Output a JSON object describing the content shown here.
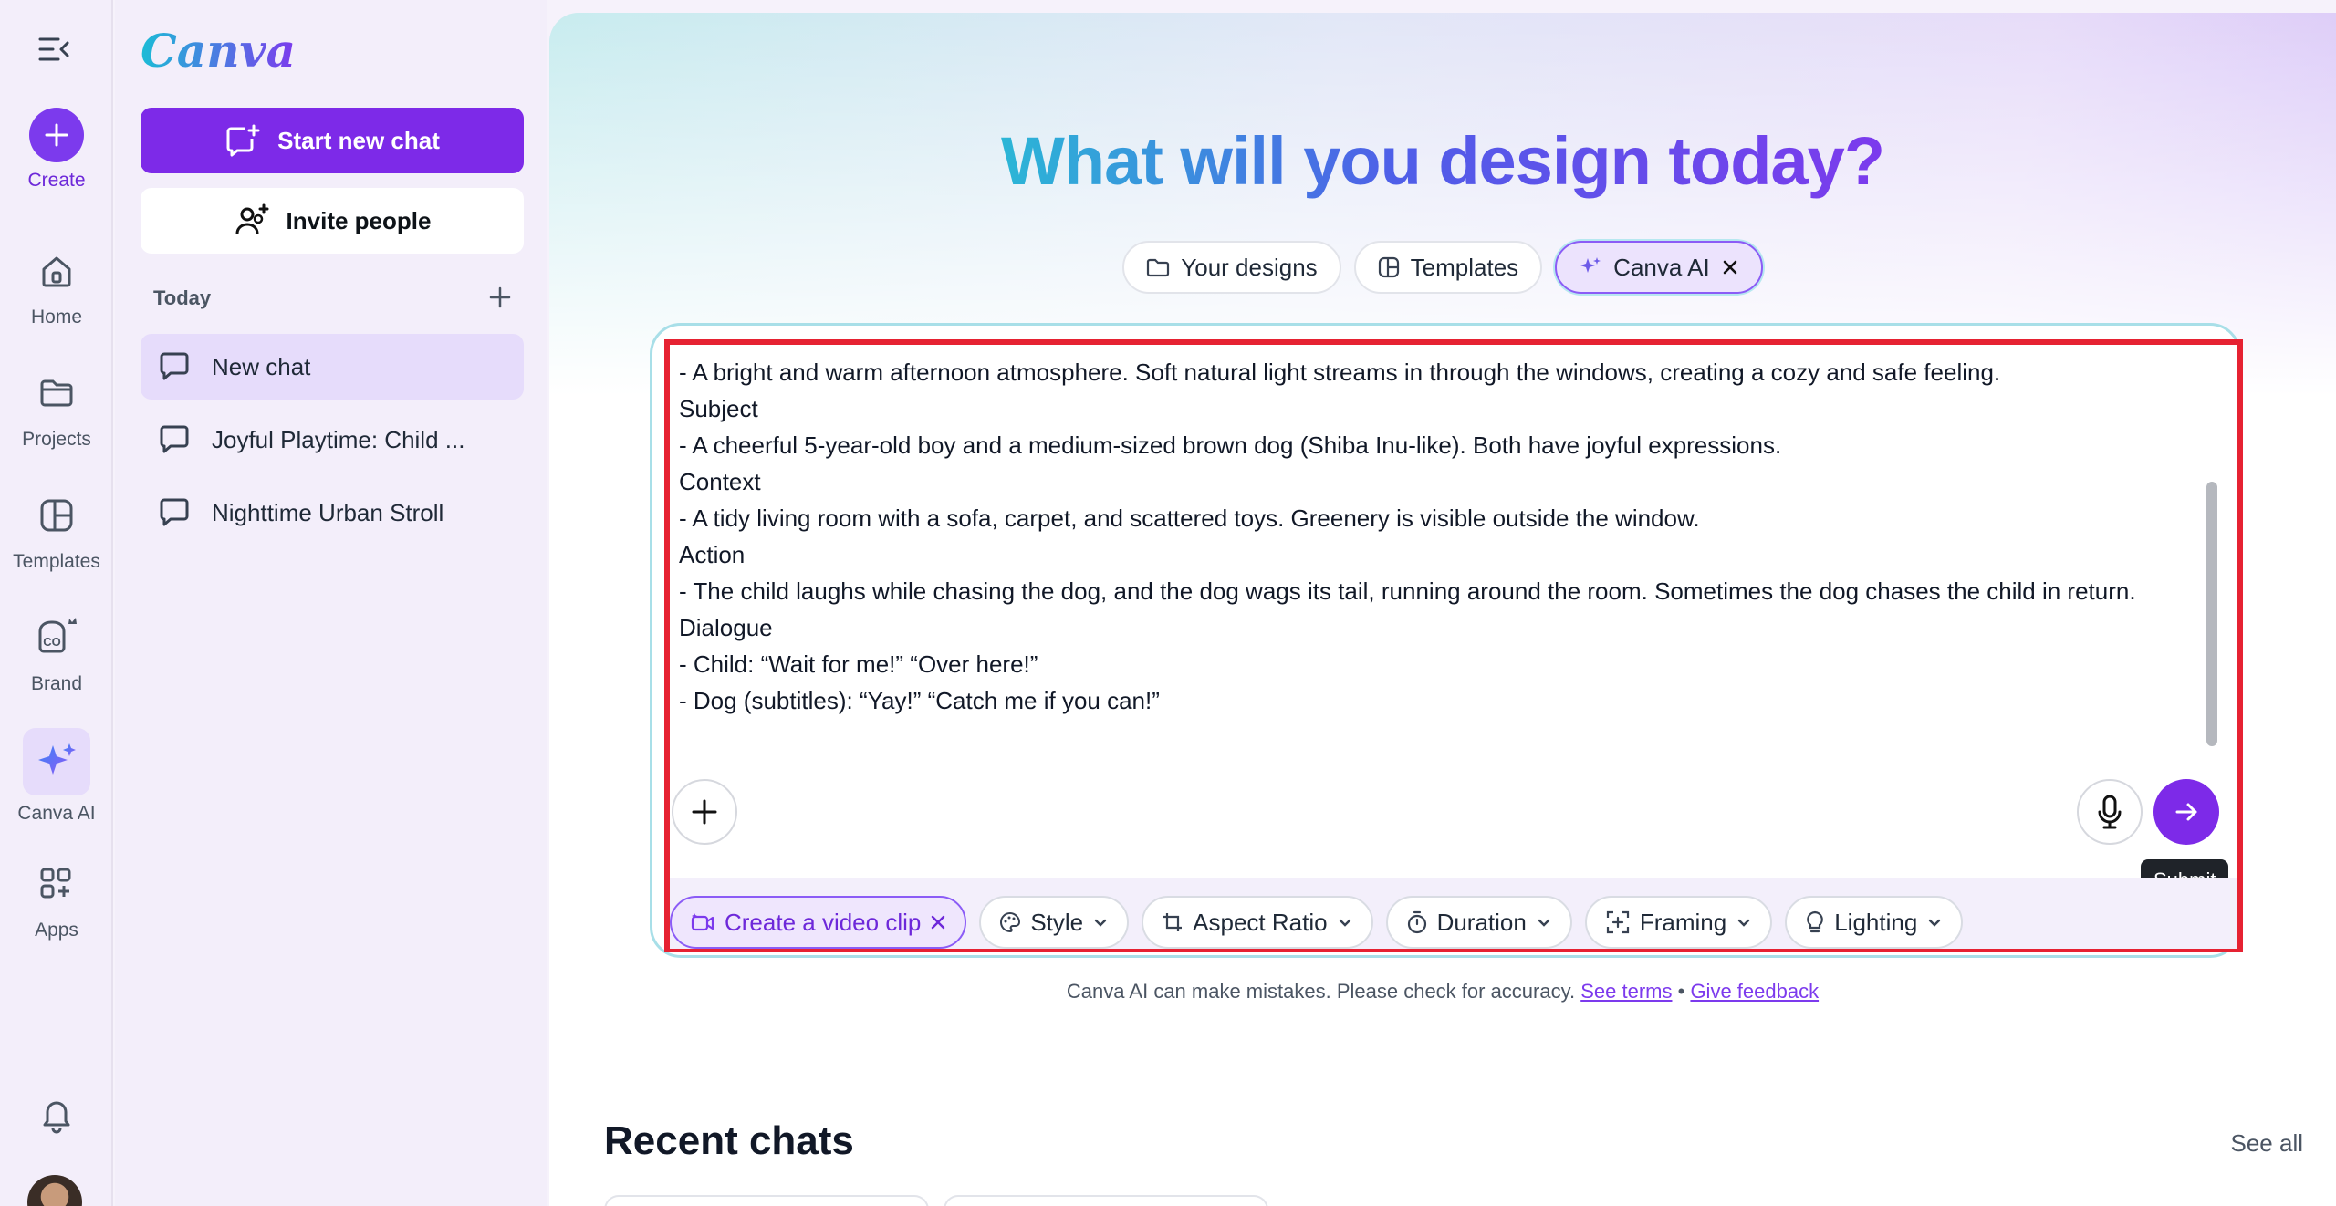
{
  "rail": {
    "items": [
      {
        "label": "Create",
        "icon": "plus-icon"
      },
      {
        "label": "Home",
        "icon": "home-icon"
      },
      {
        "label": "Projects",
        "icon": "folder-icon"
      },
      {
        "label": "Templates",
        "icon": "templates-icon"
      },
      {
        "label": "Brand",
        "icon": "brand-icon"
      },
      {
        "label": "Canva AI",
        "icon": "sparkle-icon"
      },
      {
        "label": "Apps",
        "icon": "apps-icon"
      }
    ]
  },
  "sidebar": {
    "logo": "Canva",
    "start_chat_label": "Start new chat",
    "invite_label": "Invite people",
    "section_today": "Today",
    "chats": [
      {
        "label": "New chat"
      },
      {
        "label": "Joyful Playtime: Child ..."
      },
      {
        "label": "Nighttime Urban Stroll"
      }
    ]
  },
  "main": {
    "headline": "What will you design today?",
    "tabs": [
      {
        "label": "Your designs"
      },
      {
        "label": "Templates"
      },
      {
        "label": "Canva AI"
      }
    ],
    "prompt_text": "- A bright and warm afternoon atmosphere. Soft natural light streams in through the windows, creating a cozy and safe feeling.\nSubject\n- A cheerful 5-year-old boy and a medium-sized brown dog (Shiba Inu-like). Both have joyful expressions.\nContext\n- A tidy living room with a sofa, carpet, and scattered toys. Greenery is visible outside the window.\nAction\n- The child laughs while chasing the dog, and the dog wags its tail, running around the room. Sometimes the dog chases the child in return.\nDialogue\n- Child: “Wait for me!” “Over here!”\n- Dog (subtitles): “Yay!” “Catch me if you can!”",
    "submit_tooltip": "Submit",
    "options": [
      {
        "label": "Create a video clip"
      },
      {
        "label": "Style"
      },
      {
        "label": "Aspect Ratio"
      },
      {
        "label": "Duration"
      },
      {
        "label": "Framing"
      },
      {
        "label": "Lighting"
      }
    ],
    "disclaimer_text": "Canva AI can make mistakes. Please check for accuracy.",
    "see_terms": "See terms",
    "separator": "•",
    "give_feedback": "Give feedback",
    "recent_title": "Recent chats",
    "see_all": "See all"
  },
  "colors": {
    "accent": "#7d2ae8",
    "highlight_border": "#e62232"
  }
}
